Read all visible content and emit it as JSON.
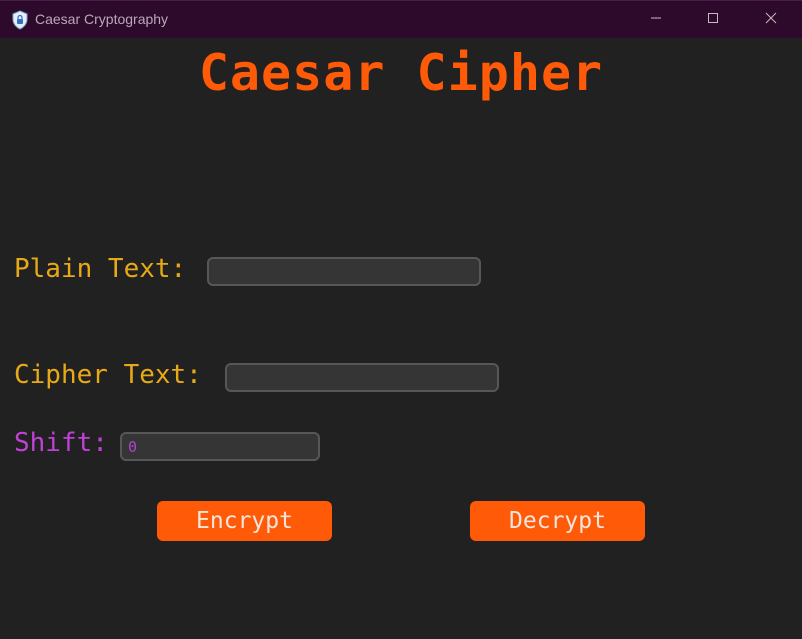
{
  "window": {
    "title": "Caesar Cryptography",
    "icon": "shield-lock-icon",
    "controls": [
      "minimize-icon",
      "maximize-icon",
      "close-icon"
    ]
  },
  "main": {
    "heading": "Caesar Cipher",
    "plain_text": {
      "label": "Plain Text:",
      "value": ""
    },
    "cipher_text": {
      "label": "Cipher Text:",
      "value": ""
    },
    "shift": {
      "label": "Shift:",
      "value": "0"
    },
    "encrypt_label": "Encrypt",
    "decrypt_label": "Decrypt"
  },
  "colors": {
    "background": "#212121",
    "titlebar": "#2d0a2b",
    "accent": "#ff5a08",
    "label": "#e8a917",
    "shift_label": "#c041d8"
  }
}
